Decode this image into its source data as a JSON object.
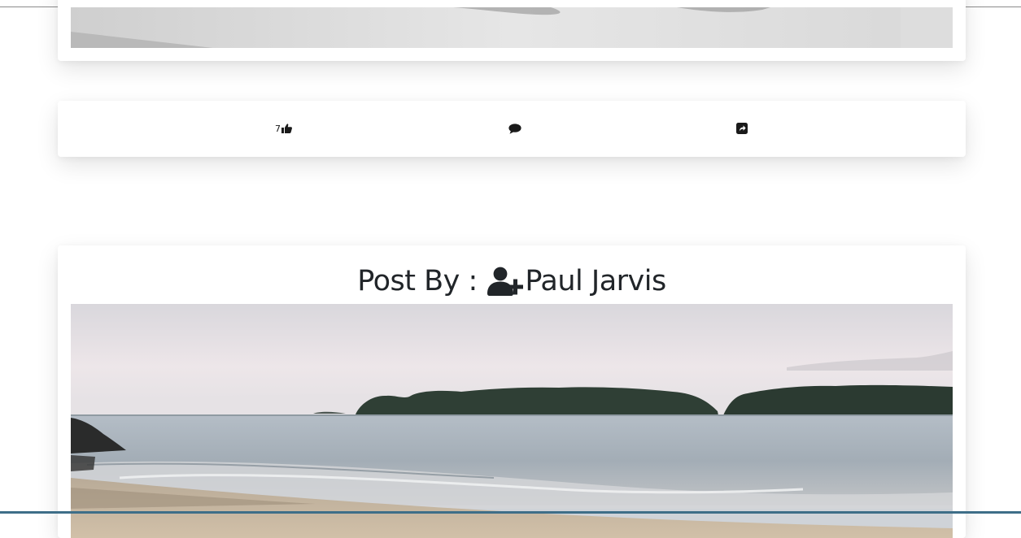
{
  "feed": {
    "actions": {
      "like_count": "7",
      "like_icon": "thumbs-up-icon",
      "comment_icon": "comment-icon",
      "share_icon": "share-square-icon"
    },
    "post": {
      "title_prefix": "Post By : ",
      "author_icon": "user-plus-icon",
      "author": "Paul Jarvis"
    }
  },
  "colors": {
    "text": "#212529",
    "card": "#ffffff",
    "shadow": "rgba(0,0,0,0.11)"
  }
}
